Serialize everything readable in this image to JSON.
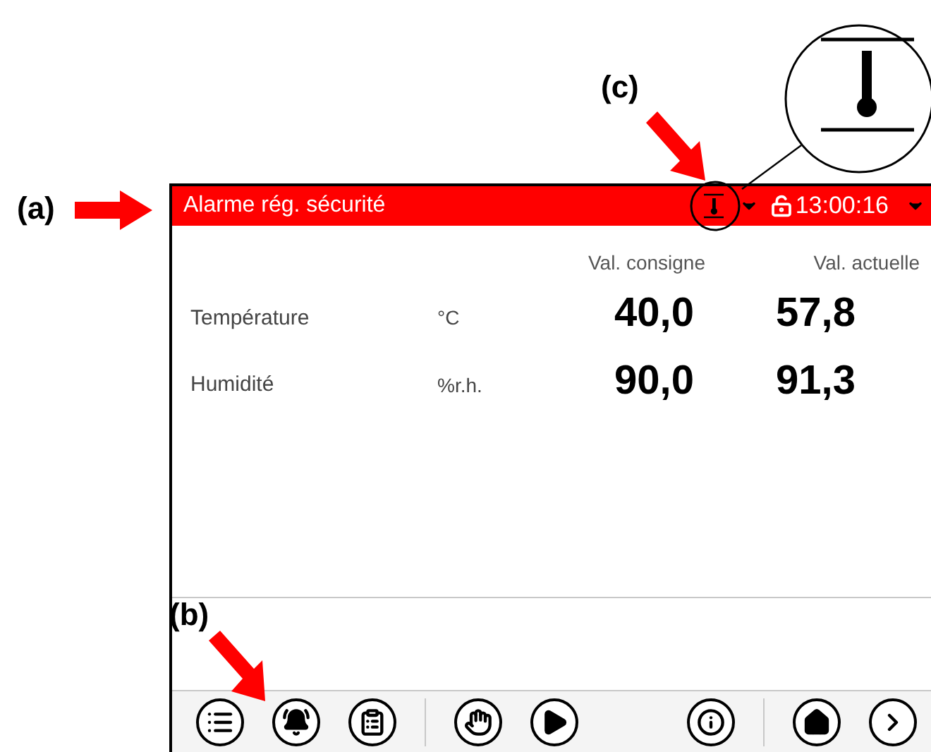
{
  "annotations": [
    {
      "label": "(a)"
    },
    {
      "label": "(b)"
    },
    {
      "label": "(c)"
    }
  ],
  "header": {
    "title": "Alarme rég. sécurité",
    "time": "13:00:16"
  },
  "columns": [
    "Val. consigne",
    "Val. actuelle"
  ],
  "rows": [
    {
      "name": "Température",
      "unit": "°C",
      "setpoint": "40,0",
      "actual": "57,8"
    },
    {
      "name": "Humidité",
      "unit": "%r.h.",
      "setpoint": "90,0",
      "actual": "91,3"
    }
  ],
  "toolbar": [
    {
      "kind": "menu"
    },
    {
      "kind": "alarm"
    },
    {
      "kind": "notes"
    },
    {
      "kind": "manual"
    },
    {
      "kind": "program"
    },
    {
      "kind": "info"
    },
    {
      "kind": "home"
    },
    {
      "kind": "next"
    }
  ]
}
